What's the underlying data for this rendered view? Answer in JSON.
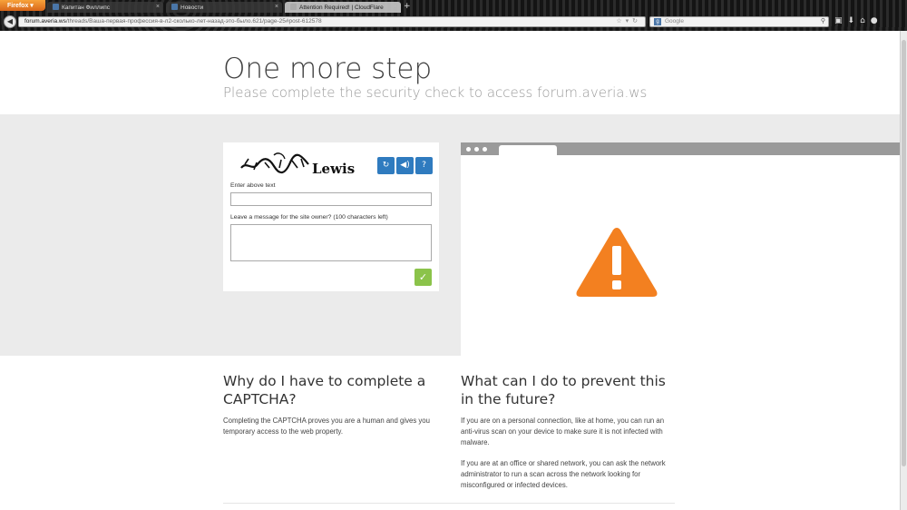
{
  "browser": {
    "app_button": "Firefox",
    "tabs": [
      {
        "label": "Капитан Филлипс",
        "active": false
      },
      {
        "label": "Новости",
        "active": false
      },
      {
        "label": "Attention Required! | CloudFlare",
        "active": true
      }
    ],
    "new_tab": "+",
    "url_domain": "forum.averia.ws",
    "url_path": "/threads/Ваша-первая-профессия-в-л2-сколько-лет-назад-это-было.621/page-25#post-612578",
    "search_engine": "Google",
    "search_placeholder": "Google"
  },
  "page": {
    "title": "One more step",
    "subtitle": "Please complete the security check to access forum.averia.ws",
    "captcha": {
      "word": "Lewis",
      "enter_label": "Enter above text",
      "enter_value": "",
      "message_label": "Leave a message for the site owner? (100 characters left)",
      "message_value": ""
    },
    "why_heading": "Why do I have to complete a CAPTCHA?",
    "why_text": "Completing the CAPTCHA proves you are a human and gives you temporary access to the web property.",
    "prevent_heading": "What can I do to prevent this in the future?",
    "prevent_text_1": "If you are on a personal connection, like at home, you can run an anti-virus scan on your device to make sure it is not infected with malware.",
    "prevent_text_2": "If you are at an office or shared network, you can ask the network administrator to run a scan across the network looking for misconfigured or infected devices."
  },
  "colors": {
    "accent_blue": "#2f7bbf",
    "submit_green": "#8bc34a",
    "warning_orange": "#f38020"
  }
}
